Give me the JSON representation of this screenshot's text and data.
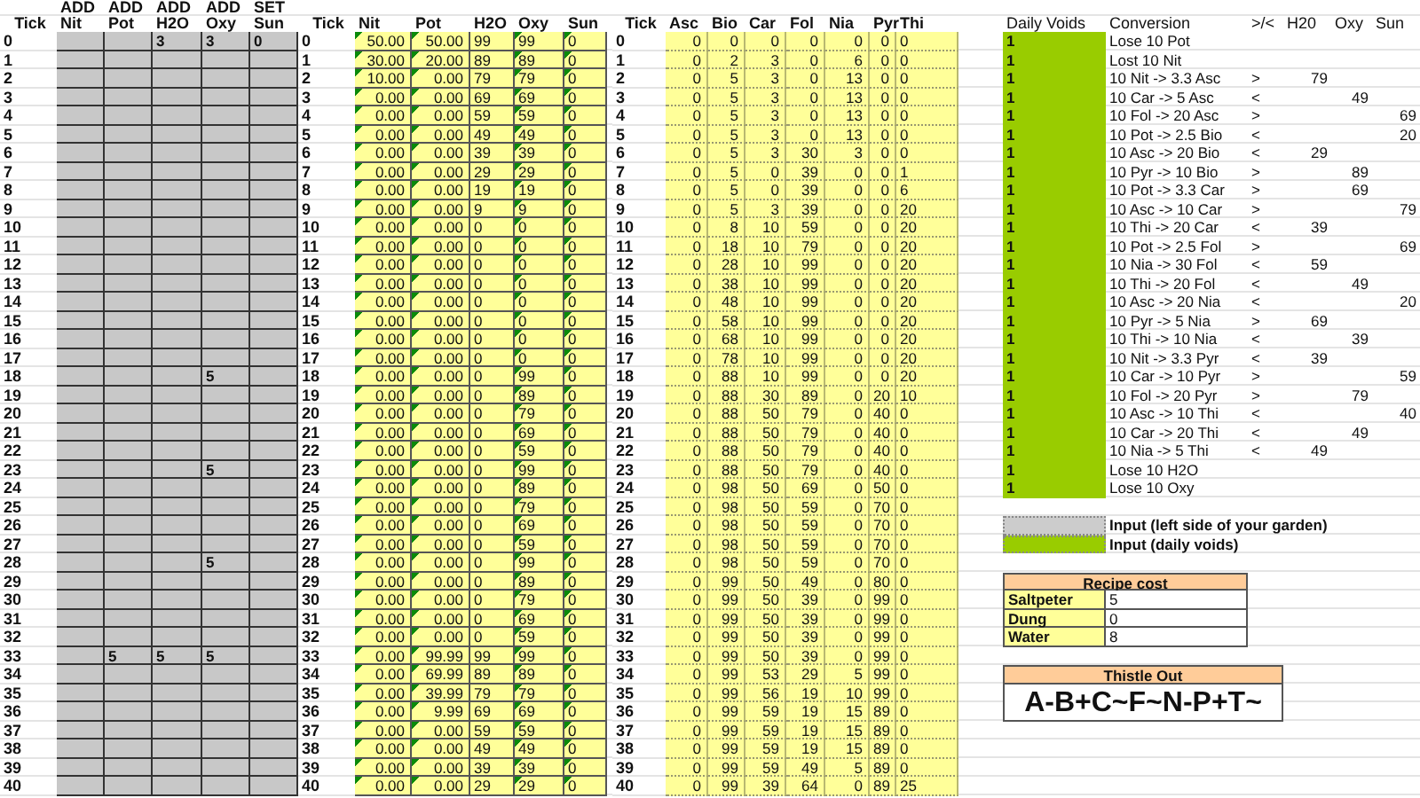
{
  "inputs": {
    "tick_header": "Tick",
    "columns": [
      {
        "action": "ADD",
        "name": "Nit"
      },
      {
        "action": "ADD",
        "name": "Pot"
      },
      {
        "action": "ADD",
        "name": "H2O"
      },
      {
        "action": "ADD",
        "name": "Oxy"
      },
      {
        "action": "SET",
        "name": "Sun"
      }
    ],
    "rows": [
      {
        "tick": "0",
        "add_h2o": "3",
        "add_oxy": "3",
        "set_sun": "0"
      },
      {
        "tick": "1"
      },
      {
        "tick": "2"
      },
      {
        "tick": "3"
      },
      {
        "tick": "4"
      },
      {
        "tick": "5"
      },
      {
        "tick": "6"
      },
      {
        "tick": "7"
      },
      {
        "tick": "8"
      },
      {
        "tick": "9"
      },
      {
        "tick": "10"
      },
      {
        "tick": "11"
      },
      {
        "tick": "12"
      },
      {
        "tick": "13"
      },
      {
        "tick": "14"
      },
      {
        "tick": "15"
      },
      {
        "tick": "16"
      },
      {
        "tick": "17"
      },
      {
        "tick": "18",
        "add_oxy": "5"
      },
      {
        "tick": "19"
      },
      {
        "tick": "20"
      },
      {
        "tick": "21"
      },
      {
        "tick": "22"
      },
      {
        "tick": "23",
        "add_oxy": "5"
      },
      {
        "tick": "24"
      },
      {
        "tick": "25"
      },
      {
        "tick": "26"
      },
      {
        "tick": "27"
      },
      {
        "tick": "28",
        "add_oxy": "5"
      },
      {
        "tick": "29"
      },
      {
        "tick": "30"
      },
      {
        "tick": "31"
      },
      {
        "tick": "32"
      },
      {
        "tick": "33",
        "add_pot": "5",
        "add_h2o": "5",
        "add_oxy": "5"
      },
      {
        "tick": "34"
      },
      {
        "tick": "35"
      },
      {
        "tick": "36"
      },
      {
        "tick": "37"
      },
      {
        "tick": "38"
      },
      {
        "tick": "39"
      },
      {
        "tick": "40"
      }
    ]
  },
  "state": {
    "tick_header": "Tick",
    "columns": [
      "Nit",
      "Pot",
      "H2O",
      "Oxy",
      "Sun"
    ],
    "rows": [
      {
        "tick": "0",
        "values": [
          "50.00",
          "50.00",
          "99",
          "99",
          "0"
        ]
      },
      {
        "tick": "1",
        "values": [
          "30.00",
          "20.00",
          "89",
          "89",
          "0"
        ]
      },
      {
        "tick": "2",
        "values": [
          "10.00",
          "0.00",
          "79",
          "79",
          "0"
        ]
      },
      {
        "tick": "3",
        "values": [
          "0.00",
          "0.00",
          "69",
          "69",
          "0"
        ]
      },
      {
        "tick": "4",
        "values": [
          "0.00",
          "0.00",
          "59",
          "59",
          "0"
        ]
      },
      {
        "tick": "5",
        "values": [
          "0.00",
          "0.00",
          "49",
          "49",
          "0"
        ]
      },
      {
        "tick": "6",
        "values": [
          "0.00",
          "0.00",
          "39",
          "39",
          "0"
        ]
      },
      {
        "tick": "7",
        "values": [
          "0.00",
          "0.00",
          "29",
          "29",
          "0"
        ]
      },
      {
        "tick": "8",
        "values": [
          "0.00",
          "0.00",
          "19",
          "19",
          "0"
        ]
      },
      {
        "tick": "9",
        "values": [
          "0.00",
          "0.00",
          "9",
          "9",
          "0"
        ]
      },
      {
        "tick": "10",
        "values": [
          "0.00",
          "0.00",
          "0",
          "0",
          "0"
        ]
      },
      {
        "tick": "11",
        "values": [
          "0.00",
          "0.00",
          "0",
          "0",
          "0"
        ]
      },
      {
        "tick": "12",
        "values": [
          "0.00",
          "0.00",
          "0",
          "0",
          "0"
        ]
      },
      {
        "tick": "13",
        "values": [
          "0.00",
          "0.00",
          "0",
          "0",
          "0"
        ]
      },
      {
        "tick": "14",
        "values": [
          "0.00",
          "0.00",
          "0",
          "0",
          "0"
        ]
      },
      {
        "tick": "15",
        "values": [
          "0.00",
          "0.00",
          "0",
          "0",
          "0"
        ]
      },
      {
        "tick": "16",
        "values": [
          "0.00",
          "0.00",
          "0",
          "0",
          "0"
        ]
      },
      {
        "tick": "17",
        "values": [
          "0.00",
          "0.00",
          "0",
          "0",
          "0"
        ]
      },
      {
        "tick": "18",
        "values": [
          "0.00",
          "0.00",
          "0",
          "99",
          "0"
        ]
      },
      {
        "tick": "19",
        "values": [
          "0.00",
          "0.00",
          "0",
          "89",
          "0"
        ]
      },
      {
        "tick": "20",
        "values": [
          "0.00",
          "0.00",
          "0",
          "79",
          "0"
        ]
      },
      {
        "tick": "21",
        "values": [
          "0.00",
          "0.00",
          "0",
          "69",
          "0"
        ]
      },
      {
        "tick": "22",
        "values": [
          "0.00",
          "0.00",
          "0",
          "59",
          "0"
        ]
      },
      {
        "tick": "23",
        "values": [
          "0.00",
          "0.00",
          "0",
          "99",
          "0"
        ]
      },
      {
        "tick": "24",
        "values": [
          "0.00",
          "0.00",
          "0",
          "89",
          "0"
        ]
      },
      {
        "tick": "25",
        "values": [
          "0.00",
          "0.00",
          "0",
          "79",
          "0"
        ]
      },
      {
        "tick": "26",
        "values": [
          "0.00",
          "0.00",
          "0",
          "69",
          "0"
        ]
      },
      {
        "tick": "27",
        "values": [
          "0.00",
          "0.00",
          "0",
          "59",
          "0"
        ]
      },
      {
        "tick": "28",
        "values": [
          "0.00",
          "0.00",
          "0",
          "99",
          "0"
        ]
      },
      {
        "tick": "29",
        "values": [
          "0.00",
          "0.00",
          "0",
          "89",
          "0"
        ]
      },
      {
        "tick": "30",
        "values": [
          "0.00",
          "0.00",
          "0",
          "79",
          "0"
        ]
      },
      {
        "tick": "31",
        "values": [
          "0.00",
          "0.00",
          "0",
          "69",
          "0"
        ]
      },
      {
        "tick": "32",
        "values": [
          "0.00",
          "0.00",
          "0",
          "59",
          "0"
        ]
      },
      {
        "tick": "33",
        "values": [
          "0.00",
          "99.99",
          "99",
          "99",
          "0"
        ]
      },
      {
        "tick": "34",
        "values": [
          "0.00",
          "69.99",
          "89",
          "89",
          "0"
        ]
      },
      {
        "tick": "35",
        "values": [
          "0.00",
          "39.99",
          "79",
          "79",
          "0"
        ]
      },
      {
        "tick": "36",
        "values": [
          "0.00",
          "9.99",
          "69",
          "69",
          "0"
        ]
      },
      {
        "tick": "37",
        "values": [
          "0.00",
          "0.00",
          "59",
          "59",
          "0"
        ]
      },
      {
        "tick": "38",
        "values": [
          "0.00",
          "0.00",
          "49",
          "49",
          "0"
        ]
      },
      {
        "tick": "39",
        "values": [
          "0.00",
          "0.00",
          "39",
          "39",
          "0"
        ]
      },
      {
        "tick": "40",
        "values": [
          "0.00",
          "0.00",
          "29",
          "29",
          "0"
        ]
      }
    ]
  },
  "vitamins": {
    "tick_header": "Tick",
    "columns": [
      "Asc",
      "Bio",
      "Car",
      "Fol",
      "Nia",
      "Pyr",
      "Thi"
    ],
    "rows": [
      {
        "tick": "0",
        "values": [
          "0",
          "0",
          "0",
          "0",
          "0",
          "0",
          "0"
        ]
      },
      {
        "tick": "1",
        "values": [
          "0",
          "2",
          "3",
          "0",
          "6",
          "0",
          "0"
        ]
      },
      {
        "tick": "2",
        "values": [
          "0",
          "5",
          "3",
          "0",
          "13",
          "0",
          "0"
        ]
      },
      {
        "tick": "3",
        "values": [
          "0",
          "5",
          "3",
          "0",
          "13",
          "0",
          "0"
        ]
      },
      {
        "tick": "4",
        "values": [
          "0",
          "5",
          "3",
          "0",
          "13",
          "0",
          "0"
        ]
      },
      {
        "tick": "5",
        "values": [
          "0",
          "5",
          "3",
          "0",
          "13",
          "0",
          "0"
        ]
      },
      {
        "tick": "6",
        "values": [
          "0",
          "5",
          "3",
          "30",
          "3",
          "0",
          "0"
        ]
      },
      {
        "tick": "7",
        "values": [
          "0",
          "5",
          "0",
          "39",
          "0",
          "0",
          "1"
        ]
      },
      {
        "tick": "8",
        "values": [
          "0",
          "5",
          "0",
          "39",
          "0",
          "0",
          "6"
        ]
      },
      {
        "tick": "9",
        "values": [
          "0",
          "5",
          "3",
          "39",
          "0",
          "0",
          "20"
        ]
      },
      {
        "tick": "10",
        "values": [
          "0",
          "8",
          "10",
          "59",
          "0",
          "0",
          "20"
        ]
      },
      {
        "tick": "11",
        "values": [
          "0",
          "18",
          "10",
          "79",
          "0",
          "0",
          "20"
        ]
      },
      {
        "tick": "12",
        "values": [
          "0",
          "28",
          "10",
          "99",
          "0",
          "0",
          "20"
        ]
      },
      {
        "tick": "13",
        "values": [
          "0",
          "38",
          "10",
          "99",
          "0",
          "0",
          "20"
        ]
      },
      {
        "tick": "14",
        "values": [
          "0",
          "48",
          "10",
          "99",
          "0",
          "0",
          "20"
        ]
      },
      {
        "tick": "15",
        "values": [
          "0",
          "58",
          "10",
          "99",
          "0",
          "0",
          "20"
        ]
      },
      {
        "tick": "16",
        "values": [
          "0",
          "68",
          "10",
          "99",
          "0",
          "0",
          "20"
        ]
      },
      {
        "tick": "17",
        "values": [
          "0",
          "78",
          "10",
          "99",
          "0",
          "0",
          "20"
        ]
      },
      {
        "tick": "18",
        "values": [
          "0",
          "88",
          "10",
          "99",
          "0",
          "0",
          "20"
        ]
      },
      {
        "tick": "19",
        "values": [
          "0",
          "88",
          "30",
          "89",
          "0",
          "20",
          "10"
        ]
      },
      {
        "tick": "20",
        "values": [
          "0",
          "88",
          "50",
          "79",
          "0",
          "40",
          "0"
        ]
      },
      {
        "tick": "21",
        "values": [
          "0",
          "88",
          "50",
          "79",
          "0",
          "40",
          "0"
        ]
      },
      {
        "tick": "22",
        "values": [
          "0",
          "88",
          "50",
          "79",
          "0",
          "40",
          "0"
        ]
      },
      {
        "tick": "23",
        "values": [
          "0",
          "88",
          "50",
          "79",
          "0",
          "40",
          "0"
        ]
      },
      {
        "tick": "24",
        "values": [
          "0",
          "98",
          "50",
          "69",
          "0",
          "50",
          "0"
        ]
      },
      {
        "tick": "25",
        "values": [
          "0",
          "98",
          "50",
          "59",
          "0",
          "70",
          "0"
        ]
      },
      {
        "tick": "26",
        "values": [
          "0",
          "98",
          "50",
          "59",
          "0",
          "70",
          "0"
        ]
      },
      {
        "tick": "27",
        "values": [
          "0",
          "98",
          "50",
          "59",
          "0",
          "70",
          "0"
        ]
      },
      {
        "tick": "28",
        "values": [
          "0",
          "98",
          "50",
          "59",
          "0",
          "70",
          "0"
        ]
      },
      {
        "tick": "29",
        "values": [
          "0",
          "99",
          "50",
          "49",
          "0",
          "80",
          "0"
        ]
      },
      {
        "tick": "30",
        "values": [
          "0",
          "99",
          "50",
          "39",
          "0",
          "99",
          "0"
        ]
      },
      {
        "tick": "31",
        "values": [
          "0",
          "99",
          "50",
          "39",
          "0",
          "99",
          "0"
        ]
      },
      {
        "tick": "32",
        "values": [
          "0",
          "99",
          "50",
          "39",
          "0",
          "99",
          "0"
        ]
      },
      {
        "tick": "33",
        "values": [
          "0",
          "99",
          "50",
          "39",
          "0",
          "99",
          "0"
        ]
      },
      {
        "tick": "34",
        "values": [
          "0",
          "99",
          "53",
          "29",
          "5",
          "99",
          "0"
        ]
      },
      {
        "tick": "35",
        "values": [
          "0",
          "99",
          "56",
          "19",
          "10",
          "99",
          "0"
        ]
      },
      {
        "tick": "36",
        "values": [
          "0",
          "99",
          "59",
          "19",
          "15",
          "89",
          "0"
        ]
      },
      {
        "tick": "37",
        "values": [
          "0",
          "99",
          "59",
          "19",
          "15",
          "89",
          "0"
        ]
      },
      {
        "tick": "38",
        "values": [
          "0",
          "99",
          "59",
          "19",
          "15",
          "89",
          "0"
        ]
      },
      {
        "tick": "39",
        "values": [
          "0",
          "99",
          "59",
          "49",
          "5",
          "89",
          "0"
        ]
      },
      {
        "tick": "40",
        "values": [
          "0",
          "99",
          "39",
          "64",
          "0",
          "89",
          "25"
        ]
      }
    ]
  },
  "conversions": {
    "columns": [
      "Daily Voids",
      "Conversion",
      ">/<",
      "H20",
      "Oxy",
      "Sun"
    ],
    "rows": [
      {
        "daily_voids": "1",
        "conversion": "Lose 10 Pot"
      },
      {
        "daily_voids": "1",
        "conversion": "Lost 10 Nit"
      },
      {
        "daily_voids": "1",
        "conversion": "10 Nit -> 3.3 Asc",
        "compare": ">",
        "h20": "79"
      },
      {
        "daily_voids": "1",
        "conversion": "10 Car -> 5 Asc",
        "compare": "<",
        "oxy": "49"
      },
      {
        "daily_voids": "1",
        "conversion": "10 Fol -> 20 Asc",
        "compare": ">",
        "sun": "69"
      },
      {
        "daily_voids": "1",
        "conversion": "10 Pot -> 2.5 Bio",
        "compare": "<",
        "sun": "20"
      },
      {
        "daily_voids": "1",
        "conversion": "10 Asc -> 20 Bio",
        "compare": "<",
        "h20": "29"
      },
      {
        "daily_voids": "1",
        "conversion": "10 Pyr -> 10 Bio",
        "compare": ">",
        "oxy": "89"
      },
      {
        "daily_voids": "1",
        "conversion": "10 Pot -> 3.3 Car",
        "compare": ">",
        "oxy": "69"
      },
      {
        "daily_voids": "1",
        "conversion": "10 Asc -> 10 Car",
        "compare": ">",
        "sun": "79"
      },
      {
        "daily_voids": "1",
        "conversion": "10 Thi -> 20 Car",
        "compare": "<",
        "h20": "39"
      },
      {
        "daily_voids": "1",
        "conversion": "10 Pot -> 2.5 Fol",
        "compare": ">",
        "sun": "69"
      },
      {
        "daily_voids": "1",
        "conversion": "10 Nia -> 30 Fol",
        "compare": "<",
        "h20": "59"
      },
      {
        "daily_voids": "1",
        "conversion": "10 Thi -> 20 Fol",
        "compare": "<",
        "oxy": "49"
      },
      {
        "daily_voids": "1",
        "conversion": "10 Asc -> 20 Nia",
        "compare": "<",
        "sun": "20"
      },
      {
        "daily_voids": "1",
        "conversion": "10 Pyr -> 5 Nia",
        "compare": ">",
        "h20": "69"
      },
      {
        "daily_voids": "1",
        "conversion": "10 Thi -> 10 Nia",
        "compare": "<",
        "oxy": "39"
      },
      {
        "daily_voids": "1",
        "conversion": "10 Nit -> 3.3 Pyr",
        "compare": "<",
        "h20": "39"
      },
      {
        "daily_voids": "1",
        "conversion": "10 Car -> 10 Pyr",
        "compare": ">",
        "sun": "59"
      },
      {
        "daily_voids": "1",
        "conversion": "10 Fol -> 20 Pyr",
        "compare": ">",
        "oxy": "79"
      },
      {
        "daily_voids": "1",
        "conversion": "10 Asc -> 10 Thi",
        "compare": "<",
        "sun": "40"
      },
      {
        "daily_voids": "1",
        "conversion": "10 Car -> 20 Thi",
        "compare": "<",
        "oxy": "49"
      },
      {
        "daily_voids": "1",
        "conversion": "10 Nia -> 5 Thi",
        "compare": "<",
        "h20": "49"
      },
      {
        "daily_voids": "1",
        "conversion": "Lose 10 H2O"
      },
      {
        "daily_voids": "1",
        "conversion": "Lose 10 Oxy"
      }
    ]
  },
  "legend": [
    {
      "label": "Input (left side of your garden)",
      "color": "#cccccc"
    },
    {
      "label": "Input (daily voids)",
      "color": "#99cc00"
    }
  ],
  "recipe_cost": {
    "title": "Recipe cost",
    "rows": [
      {
        "name": "Saltpeter",
        "value": "5"
      },
      {
        "name": "Dung",
        "value": "0"
      },
      {
        "name": "Water",
        "value": "8"
      }
    ]
  },
  "thistle_out": {
    "title": "Thistle Out",
    "value": "A-B+C~F~N-P+T~"
  }
}
